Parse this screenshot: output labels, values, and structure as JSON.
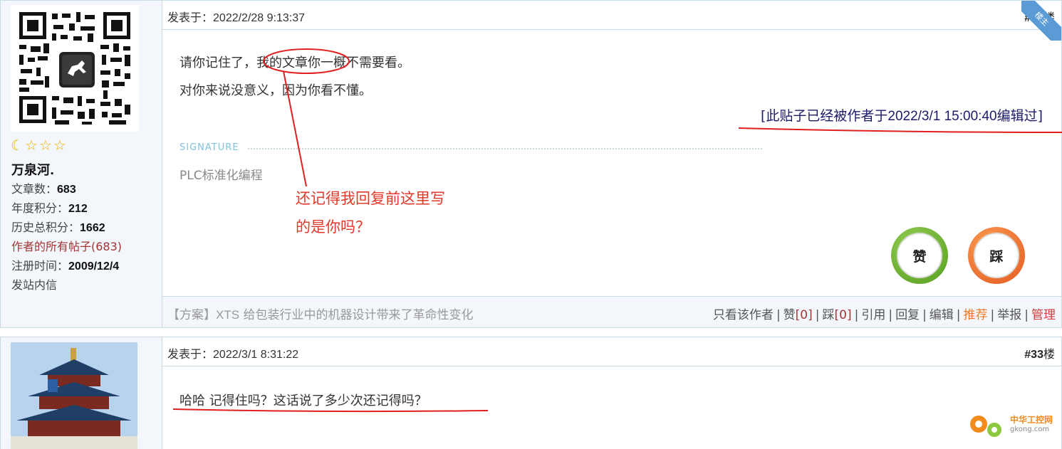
{
  "posts": [
    {
      "floor_num": "#32",
      "floor_suffix": "楼",
      "posted_label": "发表于：",
      "posted_time": "2022/2/28 9:13:37",
      "author": {
        "name": "万泉河.",
        "articles_label": "文章数：",
        "articles": "683",
        "year_points_label": "年度积分：",
        "year_points": "212",
        "total_points_label": "历史总积分：",
        "total_points": "1662",
        "all_posts_link": "作者的所有帖子(683)",
        "reg_label": "注册时间：",
        "reg_date": "2009/12/4",
        "message_link": "发站内信"
      },
      "ribbon": "楼主",
      "lines": [
        "请你记住了，我的文章你一概不需要看。",
        "对你来说没意义，因为你看不懂。"
      ],
      "edited_open": "[此贴子已经被作者于",
      "edited_time": "2022/3/1 15:00:40",
      "edited_close": "编辑过]",
      "signature_label": "SIGNATURE",
      "signature_prefix": "PLC",
      "signature_rest": "标准化编程",
      "annotation_lines": [
        "还记得我回复前这里写",
        "的是你吗？"
      ],
      "vote_like": "赞",
      "vote_dislike": "踩",
      "footer": {
        "rec_open": "【方案】",
        "rec_en": "XTS",
        "rec_rest": " 给包装行业中的机器设计带来了革命性变化",
        "only_author": "只看该作者",
        "like": "赞",
        "like_count": "[0]",
        "dislike": "踩",
        "dislike_count": "[0]",
        "quote": "引用",
        "reply": "回复",
        "edit": "编辑",
        "recommend": "推荐",
        "report": "举报",
        "manage": "管理"
      }
    },
    {
      "floor_num": "#33",
      "floor_suffix": "楼",
      "posted_label": "发表于：",
      "posted_time": "2022/3/1 8:31:22",
      "text": "哈哈 记得住吗？这话说了多少次还记得吗？",
      "watermark_cn": "中华工控网",
      "watermark_en": "gkong.com"
    }
  ],
  "colors": {
    "border": "#c8dbe6",
    "sidebar_bg": "#f3f7fb",
    "annotation_red": "#e23a2a",
    "link_red": "#a23434",
    "recommend_orange": "#ef7b2a",
    "edited_blue": "#1b1b6a"
  },
  "icons": [
    "qr-code-avatar",
    "crescent-moon-icon",
    "star-icon",
    "thumbs-up-icon",
    "thumbs-down-icon",
    "gear-logo-icon"
  ]
}
